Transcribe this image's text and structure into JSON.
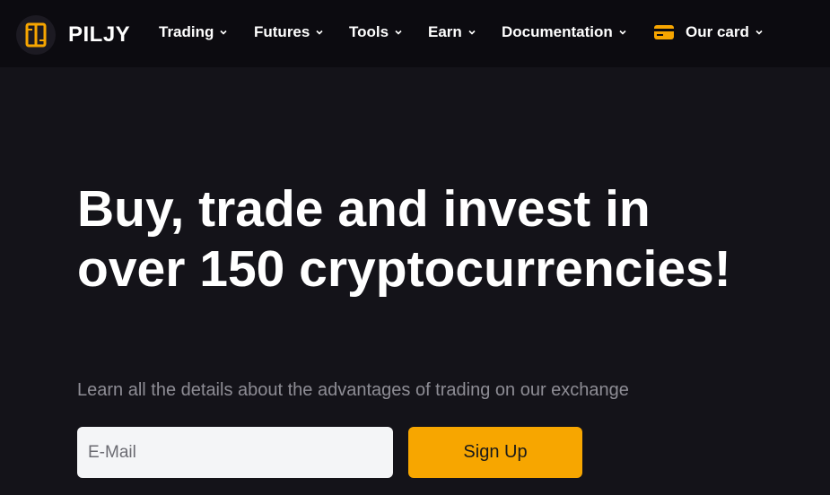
{
  "brand": {
    "name": "PILJY",
    "accent_color": "#f7a600"
  },
  "nav": {
    "items": [
      {
        "label": "Trading",
        "icon": "chevron-down-icon"
      },
      {
        "label": "Futures",
        "icon": "chevron-down-icon"
      },
      {
        "label": "Tools",
        "icon": "chevron-down-icon"
      },
      {
        "label": "Earn",
        "icon": "chevron-down-icon"
      },
      {
        "label": "Documentation",
        "icon": "chevron-down-icon"
      },
      {
        "label": "Our card",
        "icon": "chevron-down-icon",
        "leading_icon": "credit-card-icon"
      }
    ]
  },
  "hero": {
    "title": "Buy, trade and invest in over 150 cryptocurrencies!",
    "subtitle": "Learn all the details about the advantages of trading on our exchange",
    "email_placeholder": "E-Mail",
    "email_value": "",
    "signup_label": "Sign Up"
  }
}
